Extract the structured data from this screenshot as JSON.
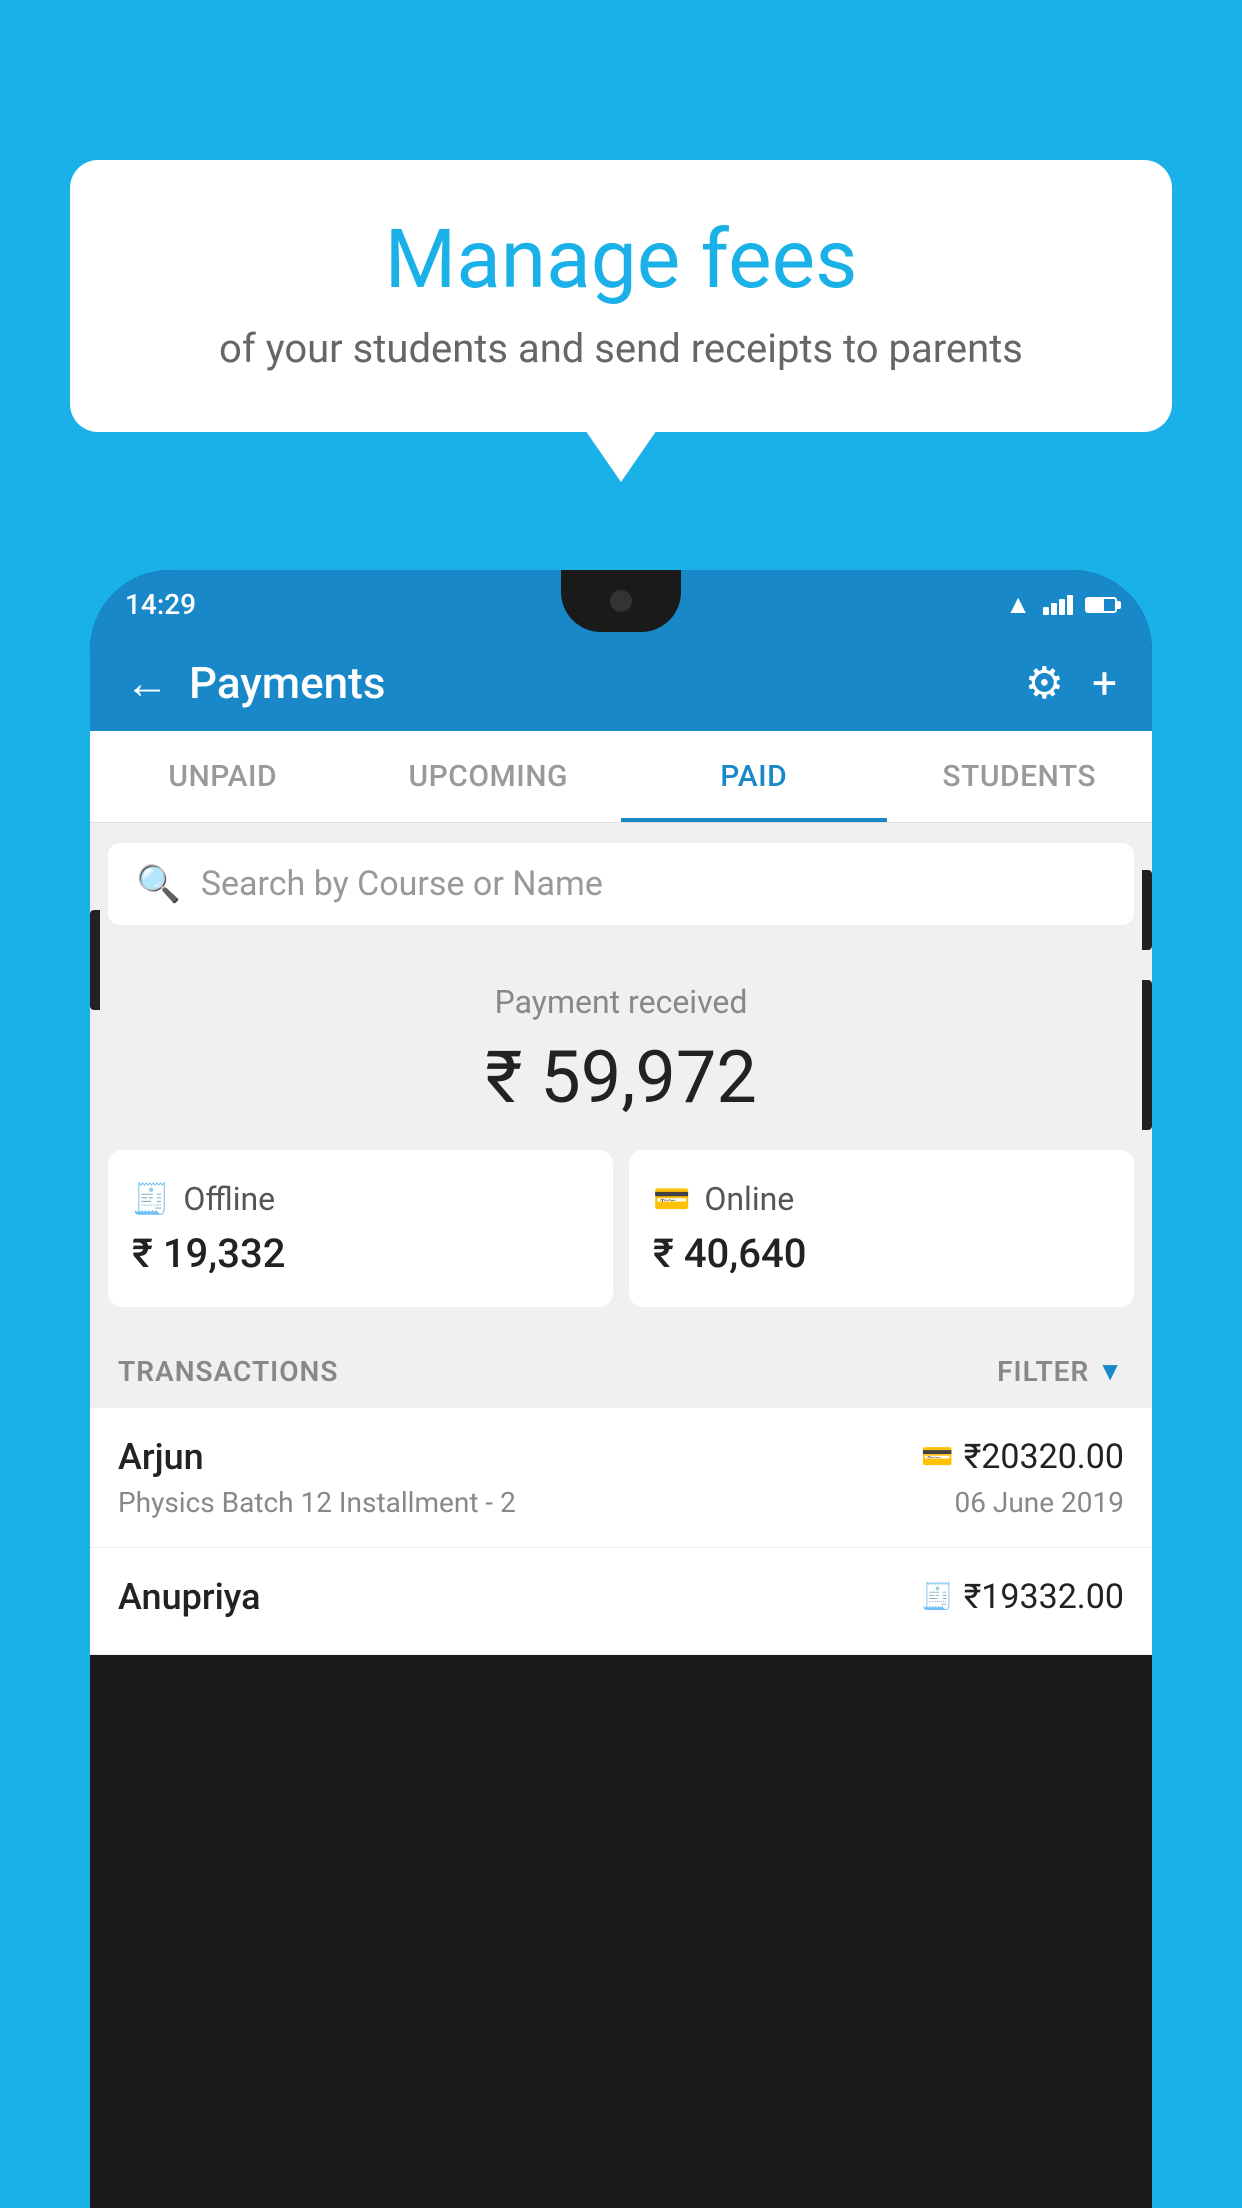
{
  "background_color": "#1ab0e8",
  "bubble": {
    "title": "Manage fees",
    "subtitle": "of your students and send receipts to parents"
  },
  "phone": {
    "status_bar": {
      "time": "14:29"
    },
    "header": {
      "title": "Payments",
      "back_label": "←",
      "settings_label": "⚙",
      "add_label": "+"
    },
    "tabs": [
      {
        "label": "UNPAID",
        "active": false
      },
      {
        "label": "UPCOMING",
        "active": false
      },
      {
        "label": "PAID",
        "active": true
      },
      {
        "label": "STUDENTS",
        "active": false
      }
    ],
    "search": {
      "placeholder": "Search by Course or Name"
    },
    "payment": {
      "label": "Payment received",
      "amount": "₹ 59,972",
      "offline": {
        "label": "Offline",
        "amount": "₹ 19,332"
      },
      "online": {
        "label": "Online",
        "amount": "₹ 40,640"
      }
    },
    "transactions": {
      "section_label": "TRANSACTIONS",
      "filter_label": "FILTER",
      "rows": [
        {
          "name": "Arjun",
          "course": "Physics Batch 12 Installment - 2",
          "amount": "₹20320.00",
          "date": "06 June 2019",
          "type": "online"
        },
        {
          "name": "Anupriya",
          "course": "",
          "amount": "₹19332.00",
          "date": "",
          "type": "offline"
        }
      ]
    }
  }
}
